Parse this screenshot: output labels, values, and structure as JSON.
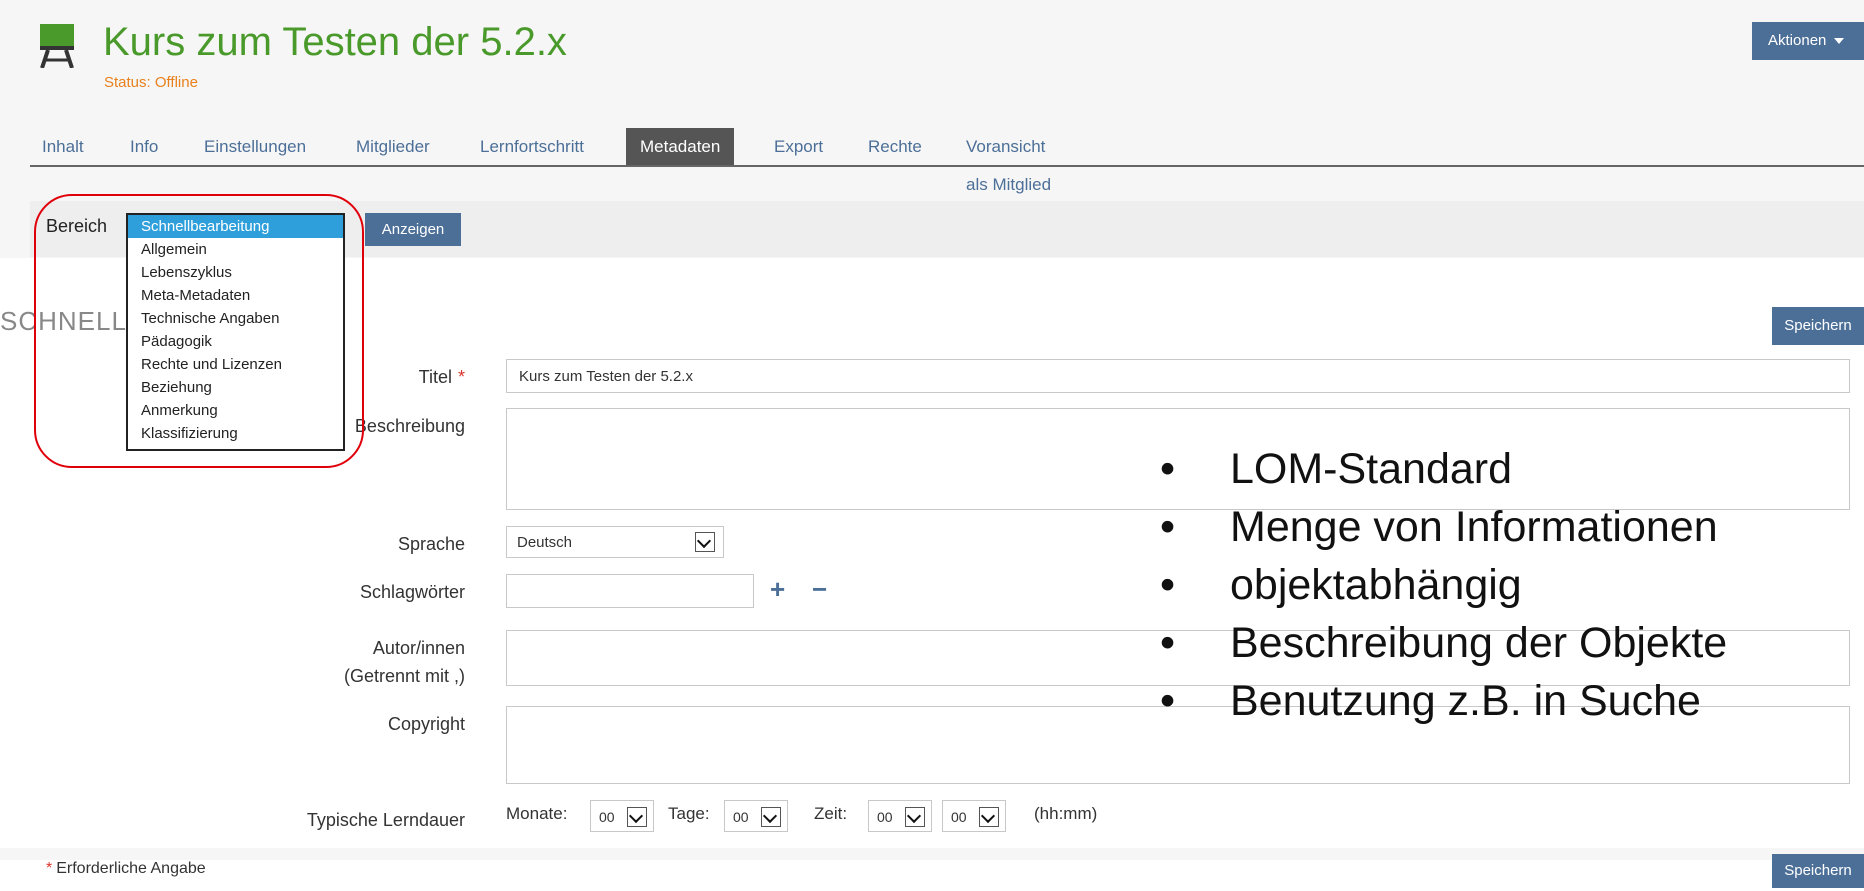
{
  "header": {
    "title": "Kurs zum Testen der 5.2.x",
    "status": "Status: Offline",
    "actions_label": "Aktionen",
    "icon": "course-easel-icon"
  },
  "tabs": [
    {
      "label": "Inhalt",
      "active": false
    },
    {
      "label": "Info",
      "active": false
    },
    {
      "label": "Einstellungen",
      "active": false
    },
    {
      "label": "Mitglieder",
      "active": false
    },
    {
      "label": "Lernfortschritt",
      "active": false
    },
    {
      "label": "Metadaten",
      "active": true
    },
    {
      "label": "Export",
      "active": false
    },
    {
      "label": "Rechte",
      "active": false
    },
    {
      "label": "Voransicht als Mitglied aktivieren",
      "active": false
    }
  ],
  "bereich": {
    "label": "Bereich",
    "options": [
      "Schnellbearbeitung",
      "Allgemein",
      "Lebenszyklus",
      "Meta-Metadaten",
      "Technische Angaben",
      "Pädagogik",
      "Rechte und Lizenzen",
      "Beziehung",
      "Anmerkung",
      "Klassifizierung"
    ],
    "selected": "Schnellbearbeitung",
    "show_button": "Anzeigen"
  },
  "form": {
    "section_heading": "SCHNELL",
    "save_label": "Speichern",
    "title_label": "Titel",
    "required_marker": "*",
    "title_value": "Kurs zum Testen der 5.2.x",
    "description_label": "Beschreibung",
    "language_label": "Sprache",
    "language_value": "Deutsch",
    "keywords_label": "Schlagwörter",
    "add_symbol": "+",
    "remove_symbol": "−",
    "authors_label": "Autor/innen",
    "authors_hint": "(Getrennt mit ,)",
    "copyright_label": "Copyright",
    "duration_label": "Typische Lerndauer",
    "months_label": "Monate:",
    "months_value": "00",
    "days_label": "Tage:",
    "days_value": "00",
    "time_label": "Zeit:",
    "hours_value": "00",
    "minutes_value": "00",
    "time_format": "(hh:mm)",
    "required_note": "Erforderliche Angabe"
  },
  "overlay": {
    "bullet_symbol": "•",
    "bullets": [
      "LOM-Standard",
      "Menge von Informationen",
      "objektabhängig",
      "Beschreibung der Objekte",
      "Benutzung z.B. in Suche"
    ]
  },
  "colors": {
    "title_green": "#4a9a2b",
    "status_orange": "#e8811d",
    "button_blue": "#4c6f98",
    "selected_option": "#2e9fdb",
    "annotation_red": "#e0000a"
  }
}
